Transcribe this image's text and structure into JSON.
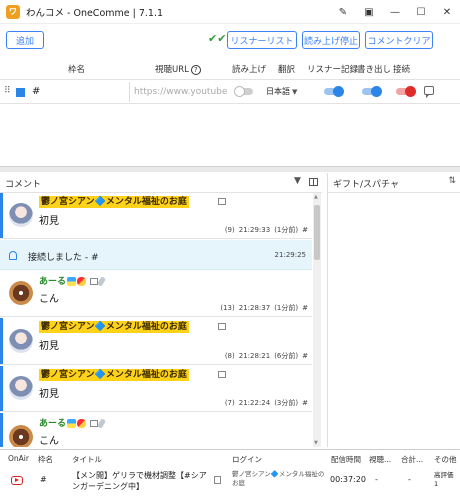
{
  "window": {
    "title": "わんコメ - OneComme | 7.1.1",
    "logo_text": "ワ"
  },
  "toolbar": {
    "add_label": "追加",
    "listener_list_label": "リスナーリスト",
    "stop_reading_label": "読み上げ停止",
    "clear_comments_label": "コメントクリア"
  },
  "room_table": {
    "headers": {
      "name": "枠名",
      "url": "視聴URL",
      "read": "読み上げ",
      "translate": "翻訳",
      "listener_record": "リスナー記録",
      "export": "書き出し",
      "connect": "接続"
    },
    "row": {
      "name": "#",
      "url_placeholder": "https://www.youtube",
      "language": "日本語",
      "color": "#2b84e8"
    }
  },
  "comment_panel": {
    "title": "コメント",
    "items": [
      {
        "name": "鬱ノ宮シアン🔷メンタル福祉のお庭",
        "text": "初見",
        "index": "(9)",
        "time": "21:29:33",
        "ago": "(1分前)",
        "room": "#"
      },
      {
        "system": true,
        "text": "接続しました - #",
        "time": "21:29:25"
      },
      {
        "name": "あーる",
        "text": "こん",
        "index": "(13)",
        "time": "21:28:37",
        "ago": "(1分前)",
        "room": "#"
      },
      {
        "name": "鬱ノ宮シアン🔷メンタル福祉のお庭",
        "text": "初見",
        "index": "(8)",
        "time": "21:28:21",
        "ago": "(6分前)",
        "room": "#"
      },
      {
        "name": "鬱ノ宮シアン🔷メンタル福祉のお庭",
        "text": "初見",
        "index": "(7)",
        "time": "21:22:24",
        "ago": "(3分前)",
        "room": "#"
      },
      {
        "name": "あーる",
        "text": "こん",
        "index": "",
        "time": "",
        "ago": "",
        "room": ""
      }
    ]
  },
  "gift_panel": {
    "title": "ギフト/スパチャ"
  },
  "bottom_table": {
    "headers": {
      "onair": "OnAir",
      "room": "枠名",
      "title": "タイトル",
      "login": "ログイン",
      "duration": "配信時間",
      "viewers": "視聴...",
      "total": "合計...",
      "other": "その他"
    },
    "row": {
      "room": "#",
      "title": "【メン閲】ゲリラで機材調整【#シアンガーデニング中】",
      "login": "鬱ノ宮シアン🔷メンタル福祉のお庭",
      "duration": "00:37:20",
      "viewers": "-",
      "total": "-",
      "other": "高評価 1"
    }
  }
}
